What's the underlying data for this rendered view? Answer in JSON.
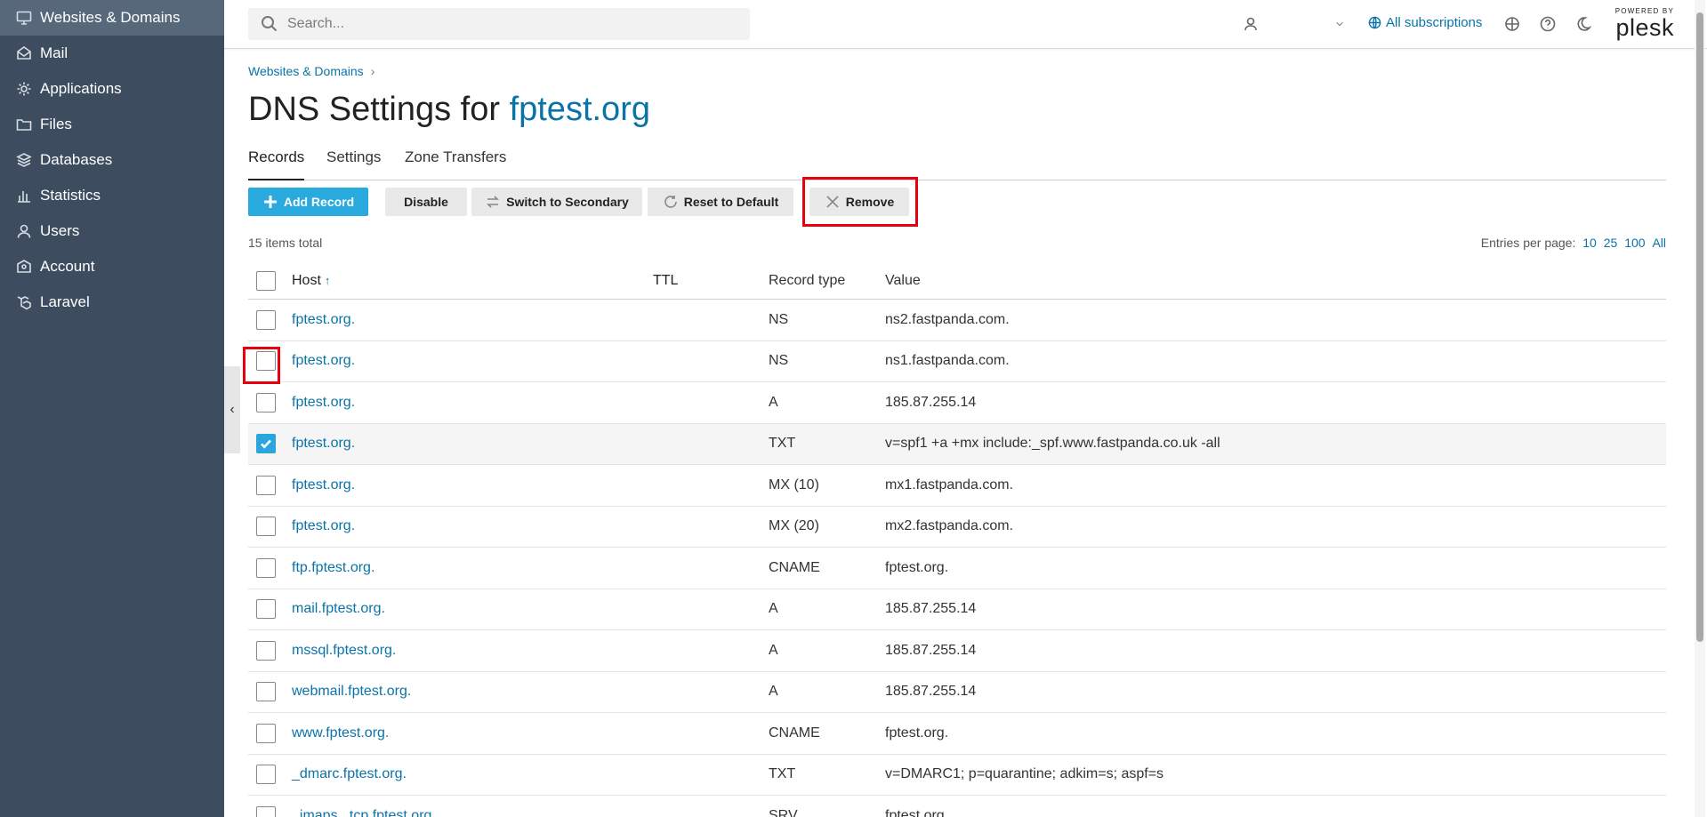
{
  "sidebar": {
    "items": [
      {
        "label": "Websites & Domains",
        "icon": "monitor-icon",
        "active": true
      },
      {
        "label": "Mail",
        "icon": "mail-icon"
      },
      {
        "label": "Applications",
        "icon": "gear-icon"
      },
      {
        "label": "Files",
        "icon": "folder-icon"
      },
      {
        "label": "Databases",
        "icon": "database-icon"
      },
      {
        "label": "Statistics",
        "icon": "bar-chart-icon"
      },
      {
        "label": "Users",
        "icon": "user-icon"
      },
      {
        "label": "Account",
        "icon": "account-icon"
      },
      {
        "label": "Laravel",
        "icon": "laravel-icon"
      }
    ],
    "collapse_glyph": "‹"
  },
  "header": {
    "search_placeholder": "Search...",
    "user_icon": "user-icon",
    "dropdown_icon": "chevron-down-icon",
    "subscriptions_label": "All subscriptions",
    "logo_powered_by": "POWERED BY",
    "logo_text": "plesk"
  },
  "breadcrumb": {
    "link": "Websites & Domains",
    "separator": "›"
  },
  "title": {
    "prefix": "DNS Settings for ",
    "domain": "fptest.org"
  },
  "tabs": [
    {
      "label": "Records",
      "active": true
    },
    {
      "label": "Settings"
    },
    {
      "label": "Zone Transfers"
    }
  ],
  "toolbar": {
    "add_record": "Add Record",
    "disable": "Disable",
    "switch_secondary": "Switch to Secondary",
    "reset_default": "Reset to Default",
    "remove": "Remove"
  },
  "list": {
    "count": "15 items total",
    "per_page_label": "Entries per page:",
    "per_page_options": [
      "10",
      "25",
      "100",
      "All"
    ]
  },
  "table": {
    "headers": {
      "host": "Host",
      "sort_glyph": "↑",
      "ttl": "TTL",
      "type": "Record type",
      "value": "Value"
    },
    "rows": [
      {
        "host": "fptest.org.",
        "ttl": "",
        "type": "NS",
        "value": "ns2.fastpanda.com.",
        "checked": false
      },
      {
        "host": "fptest.org.",
        "ttl": "",
        "type": "NS",
        "value": "ns1.fastpanda.com.",
        "checked": false
      },
      {
        "host": "fptest.org.",
        "ttl": "",
        "type": "A",
        "value": "185.87.255.14",
        "checked": false
      },
      {
        "host": "fptest.org.",
        "ttl": "",
        "type": "TXT",
        "value": "v=spf1 +a +mx include:_spf.www.fastpanda.co.uk -all",
        "checked": true
      },
      {
        "host": "fptest.org.",
        "ttl": "",
        "type": "MX (10)",
        "value": "mx1.fastpanda.com.",
        "checked": false
      },
      {
        "host": "fptest.org.",
        "ttl": "",
        "type": "MX (20)",
        "value": "mx2.fastpanda.com.",
        "checked": false
      },
      {
        "host": "ftp.fptest.org.",
        "ttl": "",
        "type": "CNAME",
        "value": "fptest.org.",
        "checked": false
      },
      {
        "host": "mail.fptest.org.",
        "ttl": "",
        "type": "A",
        "value": "185.87.255.14",
        "checked": false
      },
      {
        "host": "mssql.fptest.org.",
        "ttl": "",
        "type": "A",
        "value": "185.87.255.14",
        "checked": false
      },
      {
        "host": "webmail.fptest.org.",
        "ttl": "",
        "type": "A",
        "value": "185.87.255.14",
        "checked": false
      },
      {
        "host": "www.fptest.org.",
        "ttl": "",
        "type": "CNAME",
        "value": "fptest.org.",
        "checked": false
      },
      {
        "host": "_dmarc.fptest.org.",
        "ttl": "",
        "type": "TXT",
        "value": "v=DMARC1; p=quarantine; adkim=s; aspf=s",
        "checked": false
      },
      {
        "host": "_imaps._tcp.fptest.org.",
        "ttl": "",
        "type": "SRV",
        "value": "fptest.org.",
        "checked": false
      }
    ]
  },
  "colors": {
    "accent": "#0a73a8",
    "primary_button": "#28aade",
    "sidebar": "#3d4d5f",
    "highlight": "#e8000b"
  }
}
